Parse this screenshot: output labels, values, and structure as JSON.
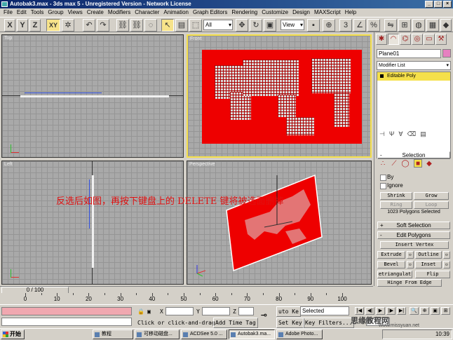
{
  "window": {
    "title": "Autobak3.max - 3ds max 5 - Unregistered Version - Network License"
  },
  "menu": [
    "File",
    "Edit",
    "Tools",
    "Group",
    "Views",
    "Create",
    "Modifiers",
    "Character",
    "Animation",
    "Graph Editors",
    "Rendering",
    "Customize",
    "Design",
    "MAXScript",
    "Help"
  ],
  "toolbar": {
    "axis_x": "X",
    "axis_y": "Y",
    "axis_z": "Z",
    "axis_xy": "XY",
    "selection_filter": "All",
    "ref_coord": "View"
  },
  "viewports": {
    "top": "Top",
    "front": "Front",
    "left": "Left",
    "perspective": "Perspective"
  },
  "annotation": "反选后如图，再按下键盘上的 DELETE 键将被选面删掉",
  "panel": {
    "object_name": "Plane01",
    "modifier_list": "Modifier List",
    "stack_item": "Editable Poly",
    "selection": {
      "header": "Selection",
      "by_vertex": "By",
      "ignore_backfacing": "Ignore",
      "shrink": "Shrink",
      "grow": "Grow",
      "ring": "Ring",
      "loop": "Loop",
      "info": "1023 Polygons Selected"
    },
    "soft_selection": "Soft Selection",
    "edit_polygons": {
      "header": "Edit Polygons",
      "insert_vertex": "Insert Vertex",
      "extrude": "Extrude",
      "outline": "Outline",
      "bevel": "Bevel",
      "inset": "Inset",
      "retriangulate": "etriangulat",
      "flip": "Flip",
      "hinge_from_edge": "Hinge From Edge",
      "extrude_along_spline": "xtrude Along Splin"
    }
  },
  "timeline": {
    "slider": "0 / 100",
    "ticks": [
      "0",
      "10",
      "20",
      "30",
      "40",
      "50",
      "60",
      "70",
      "80",
      "90",
      "100"
    ]
  },
  "status": {
    "prompt": "Click or click-and-drag",
    "add_time_tag": "Add Time Tag",
    "coord_x_label": "X",
    "coord_y_label": "Y",
    "coord_z_label": "Z",
    "auto_key": "uto Ke",
    "set_key": "Set Key",
    "key_mode": "Selected",
    "key_filters": "Key Filters...",
    "frame": "0"
  },
  "taskbar": {
    "start": "开始",
    "tasks": [
      "教程",
      "可移动磁盘...",
      "ACDSee 5.0 ...",
      "Autobak3.ma...",
      "Adobe Photo..."
    ],
    "clock": "10:39"
  },
  "watermark": {
    "main": "思缘教程网",
    "sub": "www.missyuan.net"
  },
  "colors": {
    "plane_red": "#ee0000",
    "active_viewport": "#f5e04a",
    "annotation": "#e01010"
  }
}
